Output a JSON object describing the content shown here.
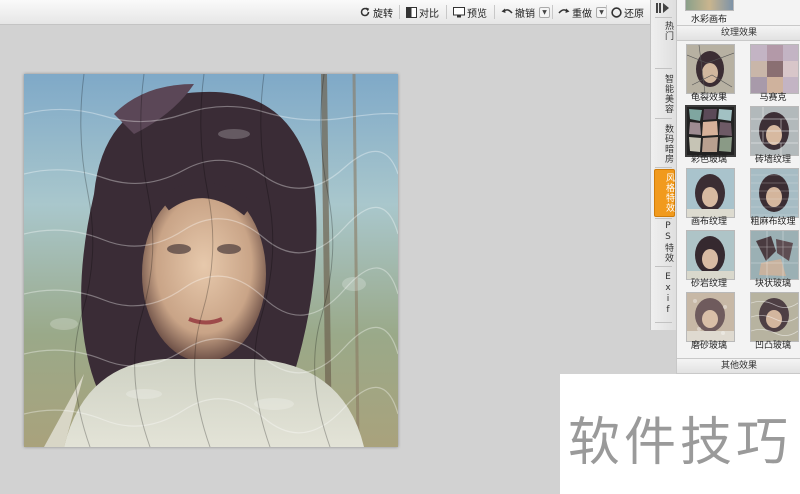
{
  "toolbar": {
    "rotate_label": "旋转",
    "compare_label": "对比",
    "preview_label": "预览",
    "undo_label": "撤销",
    "redo_label": "重做",
    "restore_label": "还原"
  },
  "side_tabs": [
    {
      "label": "热门"
    },
    {
      "label": "智能美容"
    },
    {
      "label": "数码暗房"
    },
    {
      "label": "风格特效",
      "active": true
    },
    {
      "label": "PS特效"
    },
    {
      "label": "Exif"
    }
  ],
  "effects_panel": {
    "top_item_label": "水彩画布",
    "section_title": "纹理效果",
    "items": [
      {
        "label": "龟裂效果",
        "icon": "crackle-thumb",
        "selected": false
      },
      {
        "label": "马赛克",
        "icon": "mosaic-thumb",
        "selected": false
      },
      {
        "label": "彩色玻璃",
        "icon": "stained-glass-thumb",
        "selected": true
      },
      {
        "label": "砖墙纹理",
        "icon": "brick-thumb",
        "selected": false
      },
      {
        "label": "画布纹理",
        "icon": "canvas-thumb",
        "selected": false
      },
      {
        "label": "粗麻布纹理",
        "icon": "burlap-thumb",
        "selected": false
      },
      {
        "label": "砂岩纹理",
        "icon": "sandstone-thumb",
        "selected": false
      },
      {
        "label": "块状玻璃",
        "icon": "block-glass-thumb",
        "selected": false
      },
      {
        "label": "磨砂玻璃",
        "icon": "frosted-glass-thumb",
        "selected": false
      },
      {
        "label": "凹凸玻璃",
        "icon": "bumpy-glass-thumb",
        "selected": false
      }
    ],
    "other_section_title": "其他效果"
  },
  "watermark": {
    "text": "软件技巧"
  },
  "colors": {
    "accent": "#f19a1d",
    "canvas_bg": "#d2d2d2"
  }
}
